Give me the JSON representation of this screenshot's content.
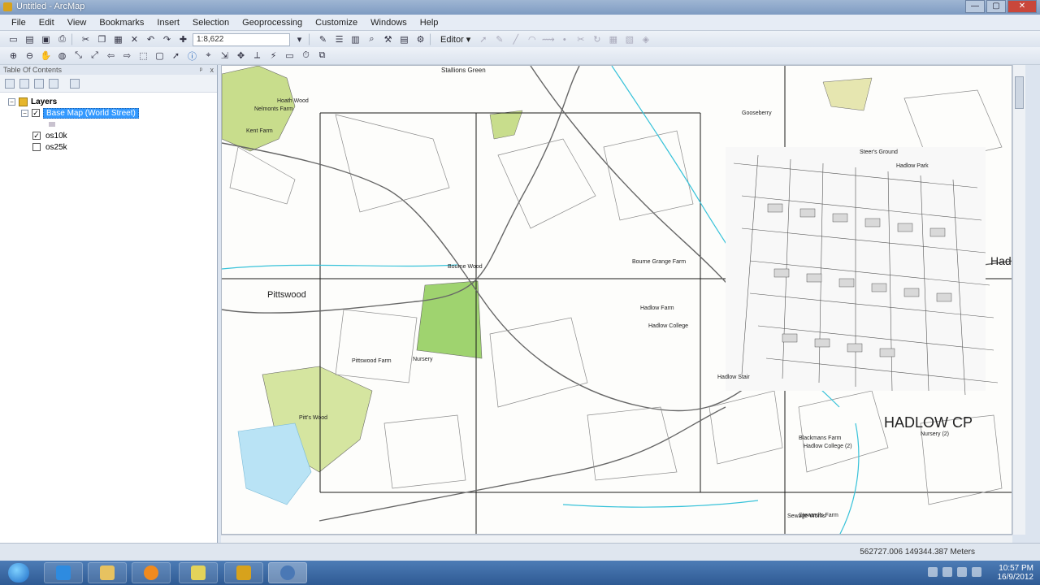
{
  "window": {
    "title": "Untitled - ArcMap",
    "buttons": {
      "minimize": "—",
      "maximize": "▢",
      "close": "✕"
    }
  },
  "menu": [
    "File",
    "Edit",
    "View",
    "Bookmarks",
    "Insert",
    "Selection",
    "Geoprocessing",
    "Customize",
    "Windows",
    "Help"
  ],
  "toolbar": {
    "scale": "1:8,622",
    "editor_label": "Editor ▾"
  },
  "toc": {
    "header": "Table Of Contents",
    "pin": "ᵖ",
    "close": "x",
    "root": "Layers",
    "layers": [
      {
        "name": "Base Map (World Street)",
        "checked": true,
        "selected": true
      },
      {
        "name": "os10k",
        "checked": true,
        "selected": false
      },
      {
        "name": "os25k",
        "checked": false,
        "selected": false
      }
    ]
  },
  "map": {
    "labels": [
      "Stallions Green",
      "Pittswood",
      "Pitt's Wood",
      "HADLOW CP",
      "Hadlow College",
      "Hadlow Park",
      "Bourne Wood",
      "Nursery",
      "Steer's Ground",
      "Nelmonts Farm",
      "Bourne Grange Farm",
      "Gooseberry",
      "Hadlow Farm",
      "Steward's Farm",
      "Hadlow Stair",
      "Had",
      "Kent Farm",
      "Hoath Wood",
      "Sewage Works",
      "Nursery (2)",
      "Pittswood Farm",
      "Blackmans Farm",
      "Hadlow College (2)"
    ]
  },
  "status": {
    "coordinates": "562727.006  149344.387 Meters"
  },
  "taskbar": {
    "time": "10:57 PM",
    "date": "16/9/2012"
  }
}
